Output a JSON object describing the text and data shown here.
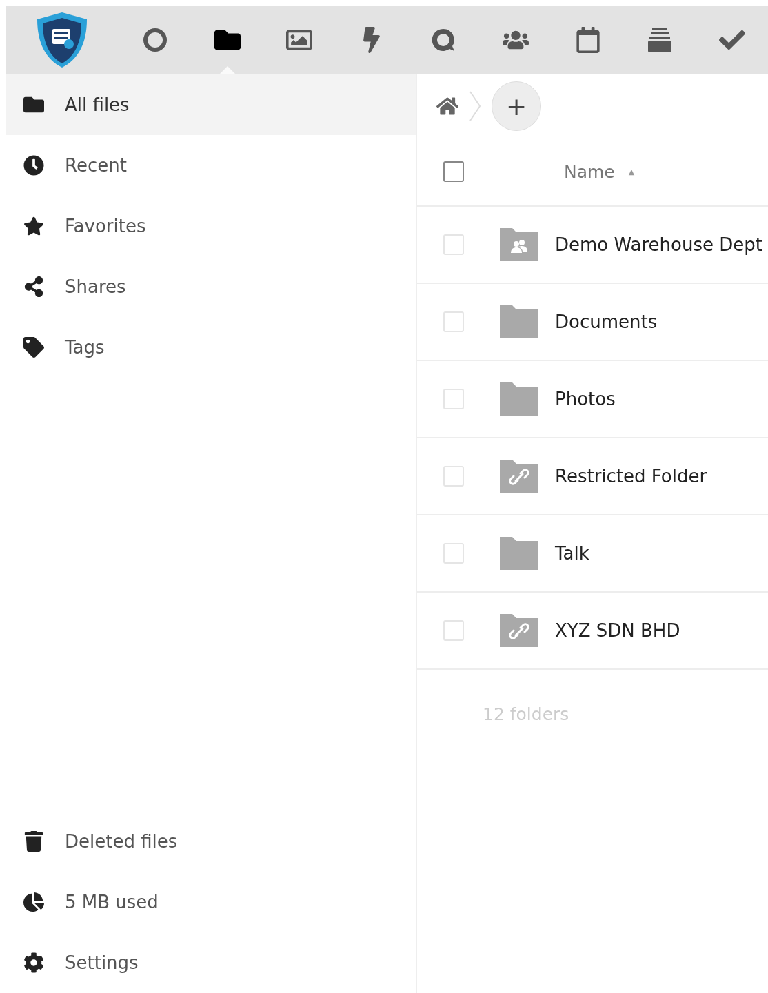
{
  "app_bar": {
    "apps": [
      {
        "kind": "dashboard",
        "selected": false
      },
      {
        "kind": "files",
        "selected": true
      },
      {
        "kind": "photos",
        "selected": false
      },
      {
        "kind": "activity",
        "selected": false
      },
      {
        "kind": "talk",
        "selected": false
      },
      {
        "kind": "contacts",
        "selected": false
      },
      {
        "kind": "calendar",
        "selected": false
      },
      {
        "kind": "deck",
        "selected": false
      },
      {
        "kind": "tasks",
        "selected": false
      }
    ]
  },
  "sidebar": {
    "items": [
      {
        "kind": "folder",
        "label": "All files",
        "selected": true
      },
      {
        "kind": "clock",
        "label": "Recent",
        "selected": false
      },
      {
        "kind": "star",
        "label": "Favorites",
        "selected": false
      },
      {
        "kind": "share",
        "label": "Shares",
        "selected": false
      },
      {
        "kind": "tag",
        "label": "Tags",
        "selected": false
      }
    ],
    "bottom_items": [
      {
        "kind": "trash",
        "label": "Deleted files"
      },
      {
        "kind": "quota",
        "label": "5 MB used"
      },
      {
        "kind": "settings",
        "label": "Settings"
      }
    ]
  },
  "breadcrumb": {
    "add_button": "+"
  },
  "table": {
    "select_all": {
      "checked": false
    },
    "columns": [
      {
        "label": "Name",
        "sort_indicator": "▲"
      }
    ],
    "rows": [
      {
        "kind": "group",
        "name": "Demo Warehouse Dept",
        "checked": false
      },
      {
        "kind": "folder",
        "name": "Documents",
        "checked": false
      },
      {
        "kind": "folder",
        "name": "Photos",
        "checked": false
      },
      {
        "kind": "link",
        "name": "Restricted Folder",
        "checked": false
      },
      {
        "kind": "folder",
        "name": "Talk",
        "checked": false
      },
      {
        "kind": "link",
        "name": "XYZ SDN BHD",
        "checked": false
      }
    ],
    "summary": "12 folders"
  }
}
